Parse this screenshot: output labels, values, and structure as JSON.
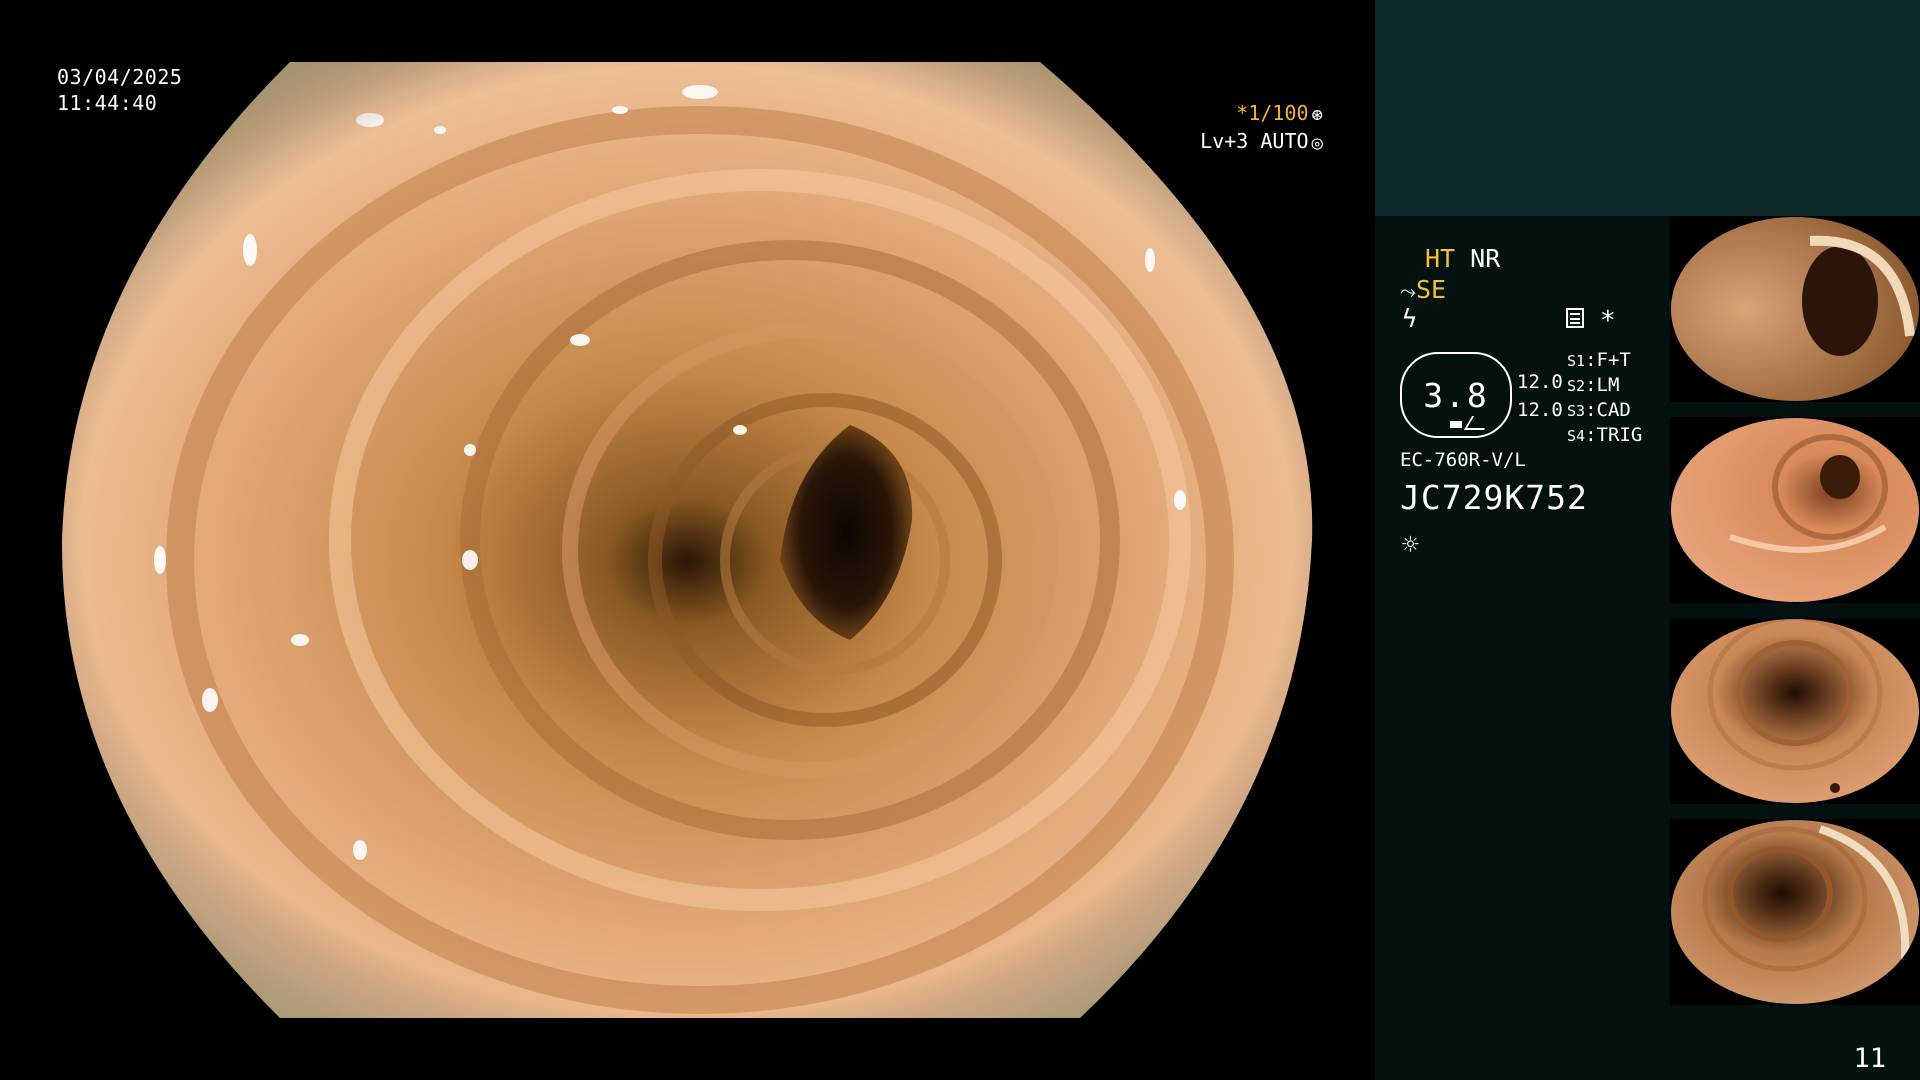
{
  "overlay": {
    "date": "03/04/2025",
    "time": "11:44:40",
    "shutter_speed": "*1/100",
    "shutter_icon": "aperture-icon",
    "level": "Lv+3 AUTO",
    "level_icon": "target-icon"
  },
  "panel": {
    "mode_ht": "HT",
    "mode_nr": "NR",
    "mode_se": "SE",
    "se_icon": "scope-icon",
    "freeze_icon": "lightning-icon",
    "menu_icon": "menu-icon",
    "star": "*",
    "aperture_value": "3.8",
    "readout_1": "12.0",
    "readout_2": "12.0",
    "switches": [
      {
        "label": "S1",
        "value": "F+T"
      },
      {
        "label": "S2",
        "value": "LM"
      },
      {
        "label": "S3",
        "value": "CAD"
      },
      {
        "label": "S4",
        "value": "TRIG"
      }
    ],
    "scope_model": "EC-760R-V/L",
    "serial": "JC729K752",
    "light_icon": "sun-icon",
    "frame_counter": "11"
  },
  "colors": {
    "panel_bg": "#031210",
    "panel_top": "#0e2a2a",
    "accent_yellow": "#f4c12f",
    "mucosa": "#d9915a",
    "lumen": "#1a0d06"
  }
}
